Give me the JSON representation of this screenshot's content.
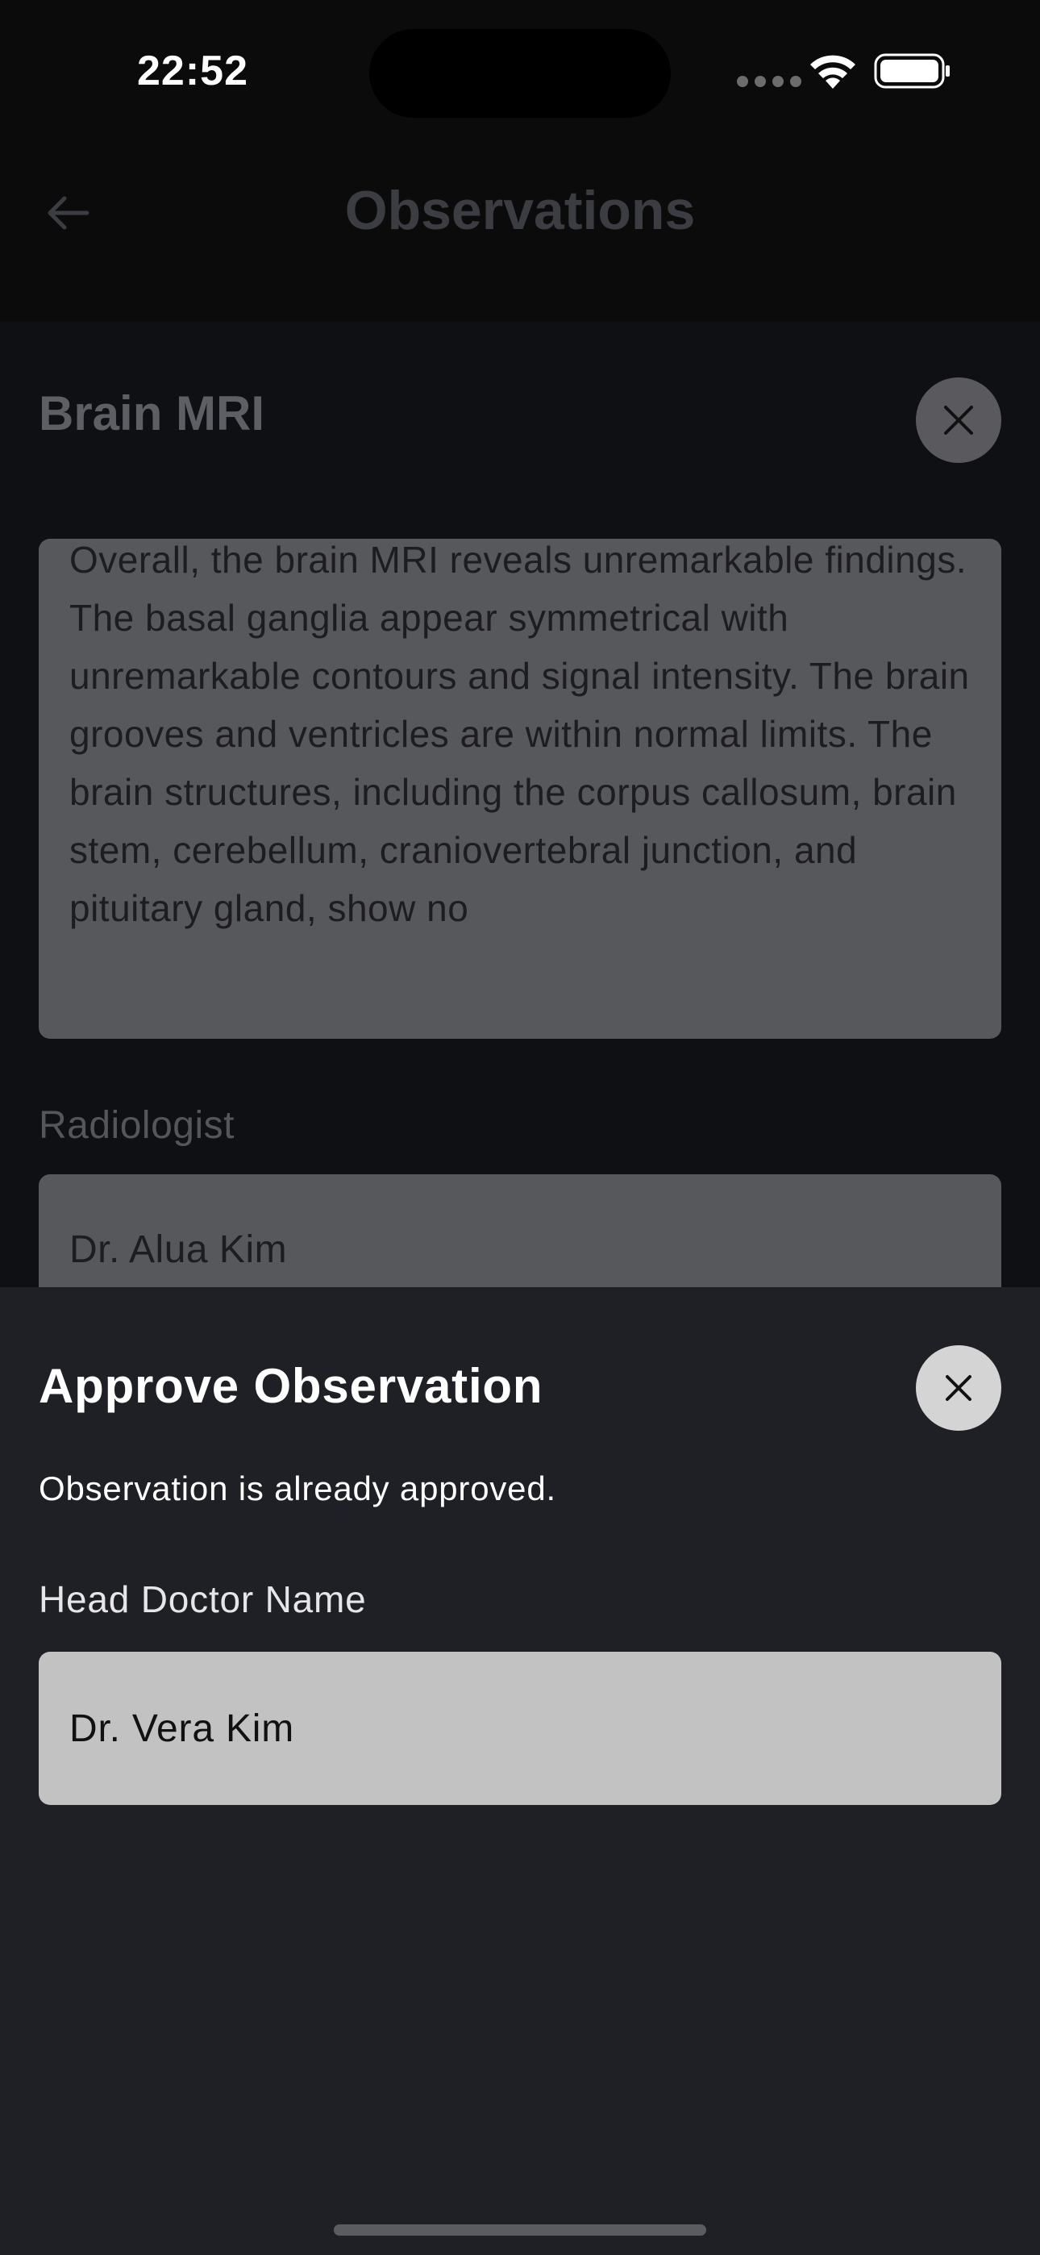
{
  "status_bar": {
    "time": "22:52"
  },
  "header": {
    "title": "Observations"
  },
  "card": {
    "title": "Brain MRI",
    "observation_text": "Overall, the brain MRI reveals unremarkable findings. The basal ganglia appear symmetrical with unremarkable contours and signal intensity. The brain grooves and ventricles are within normal limits. The brain structures, including the corpus callosum, brain stem, cerebellum, craniovertebral junction, and pituitary gland, show no",
    "radiologist_label": "Radiologist",
    "radiologist_value": "Dr. Alua Kim"
  },
  "sheet": {
    "title": "Approve Observation",
    "message": "Observation is already approved.",
    "head_doctor_label": "Head Doctor Name",
    "head_doctor_value": "Dr. Vera Kim"
  },
  "icons": {
    "back": "arrow-left-icon",
    "close": "close-icon",
    "wifi": "wifi-icon",
    "battery": "battery-icon"
  }
}
